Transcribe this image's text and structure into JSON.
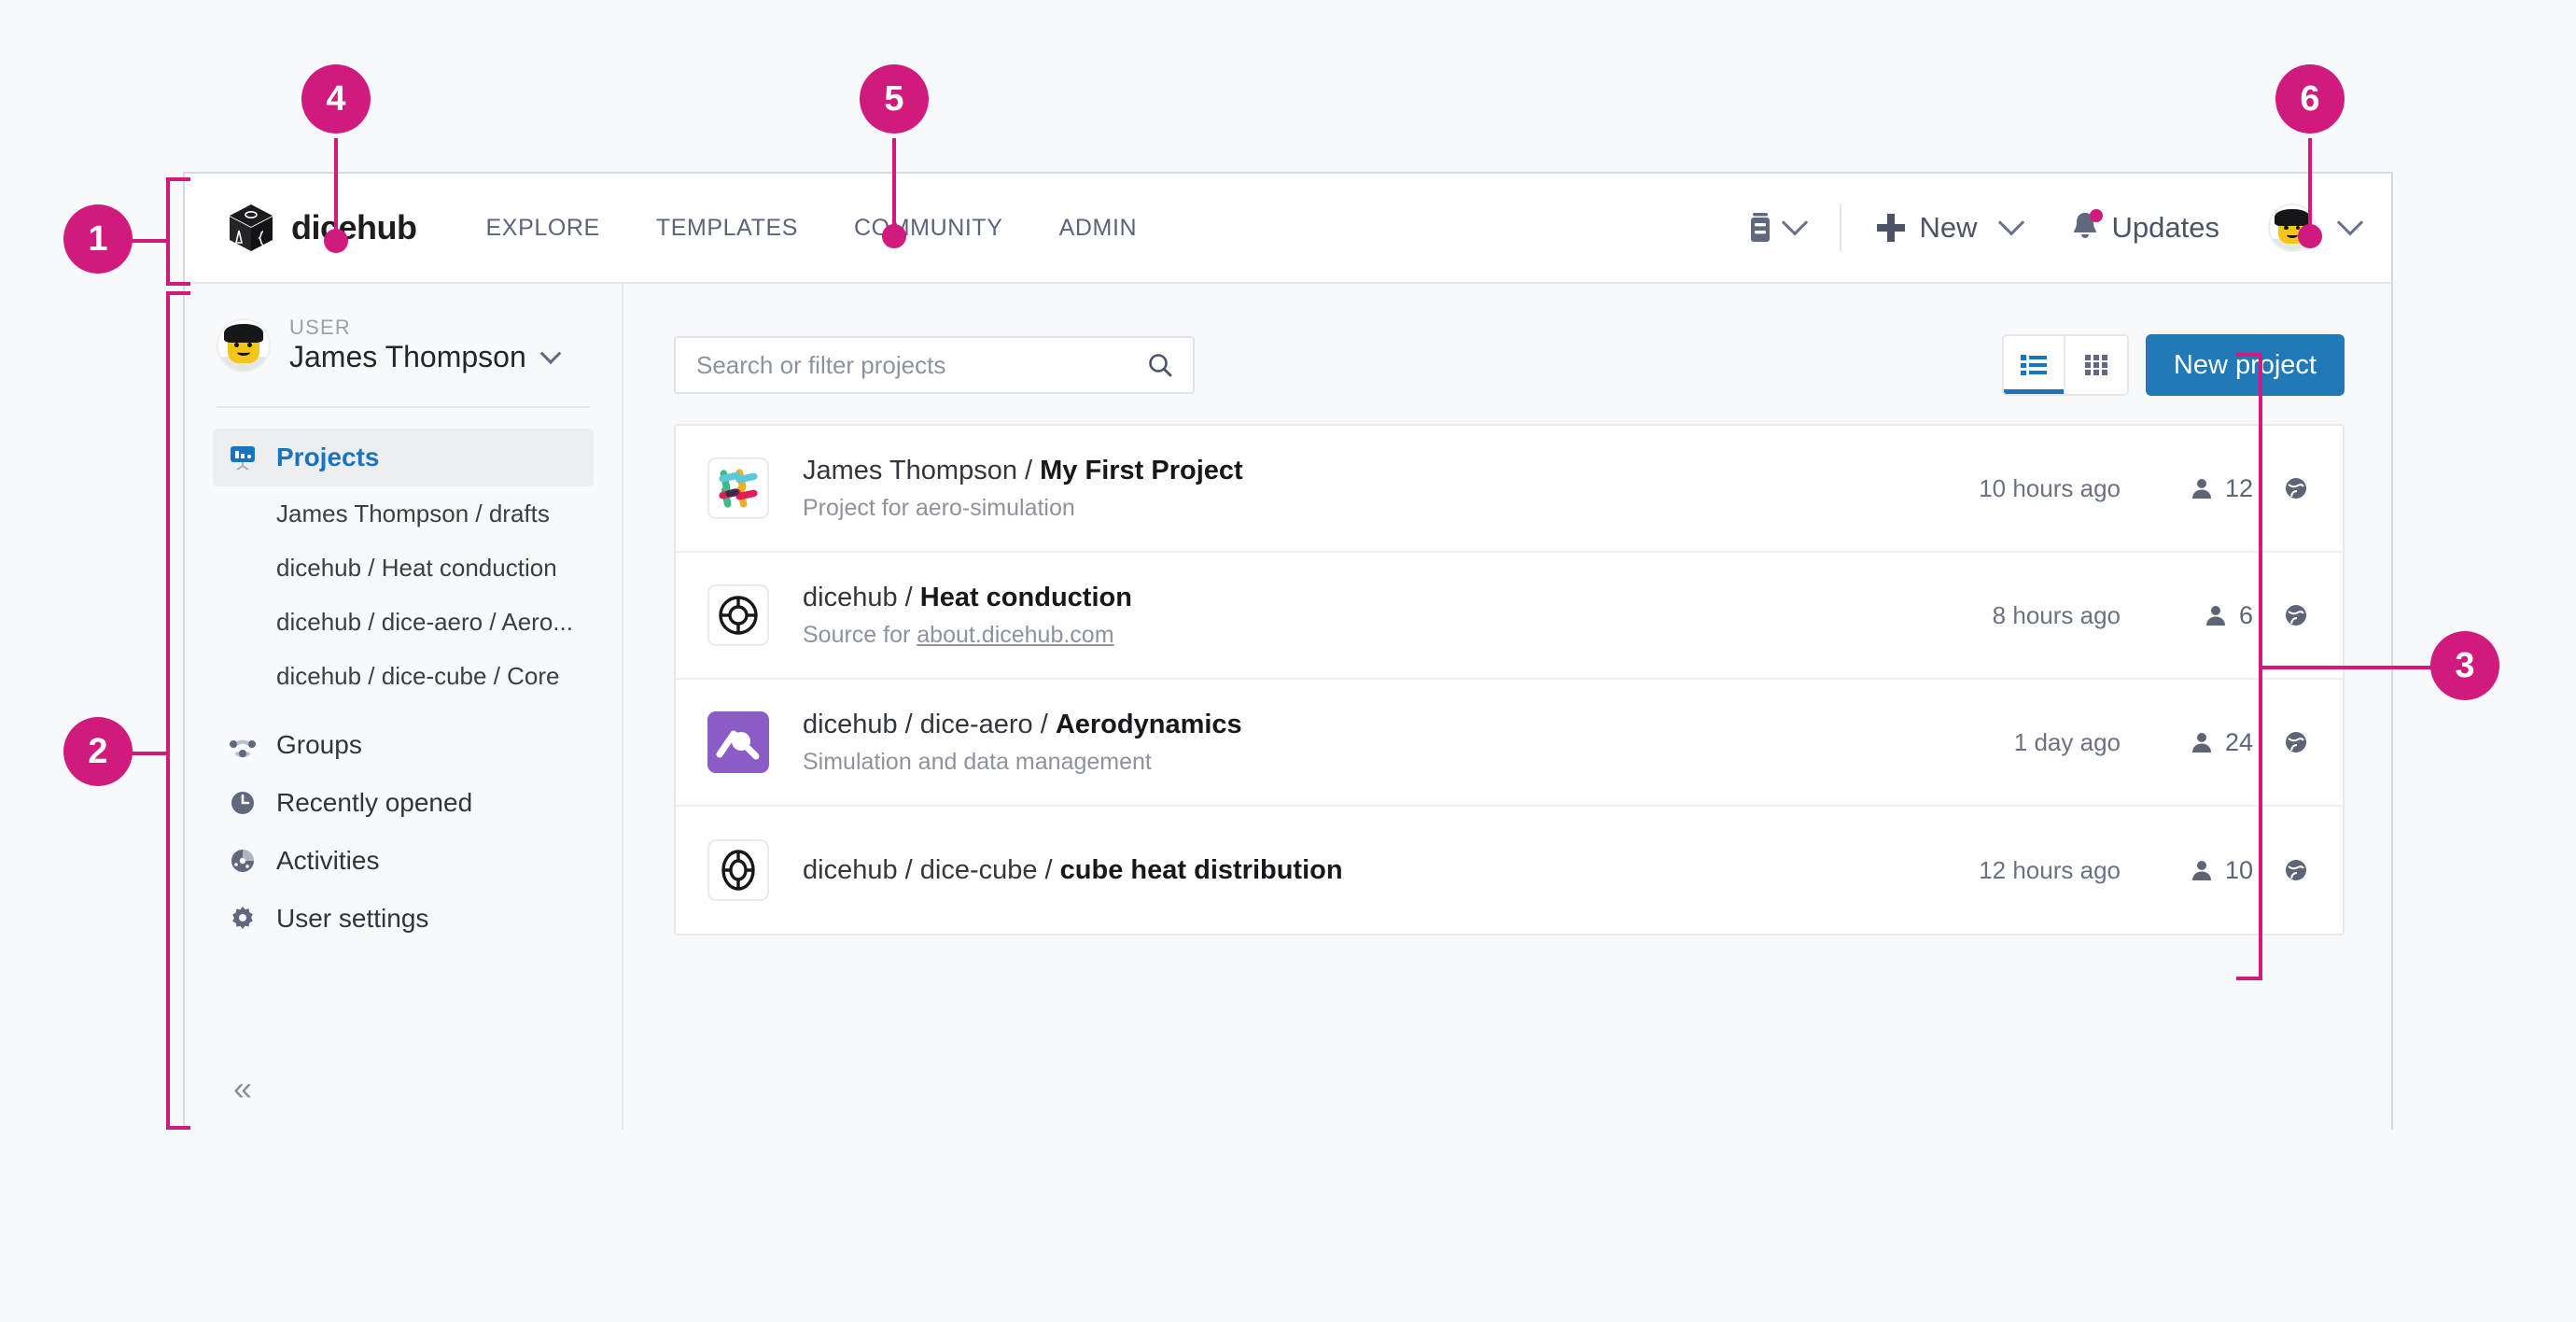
{
  "header": {
    "brand_name": "dicehub",
    "brand_icon": "dicehub-cube-logo",
    "nav": [
      {
        "label": "EXPLORE",
        "name": "nav-explore"
      },
      {
        "label": "TEMPLATES",
        "name": "nav-templates"
      },
      {
        "label": "COMMUNITY",
        "name": "nav-community"
      },
      {
        "label": "ADMIN",
        "name": "nav-admin"
      }
    ],
    "storage_icon": "database-icon",
    "new_label": "New",
    "new_icon": "plus-icon",
    "updates_label": "Updates",
    "updates_icon": "bell-icon",
    "updates_has_badge": true,
    "avatar_icon": "user-avatar",
    "chevron_icon": "chevron-down-icon"
  },
  "sidebar": {
    "user_label": "USER",
    "user_name": "James Thompson",
    "avatar_icon": "user-avatar",
    "chevron_icon": "chevron-down-icon",
    "projects": {
      "label": "Projects",
      "icon": "presentation-chart-icon"
    },
    "project_items": [
      {
        "label": "James Thompson / drafts",
        "name": "sidebar-project-drafts"
      },
      {
        "label": "dicehub / Heat conduction",
        "name": "sidebar-project-heat-conduction"
      },
      {
        "label": "dicehub / dice-aero / Aero...",
        "name": "sidebar-project-aero"
      },
      {
        "label": "dicehub / dice-cube / Core",
        "name": "sidebar-project-core"
      }
    ],
    "nav_items": [
      {
        "label": "Groups",
        "icon": "groups-network-icon",
        "name": "sidebar-item-groups"
      },
      {
        "label": "Recently opened",
        "icon": "clock-icon",
        "name": "sidebar-item-recently-opened"
      },
      {
        "label": "Activities",
        "icon": "activity-pie-icon",
        "name": "sidebar-item-activities"
      },
      {
        "label": "User settings",
        "icon": "gear-icon",
        "name": "sidebar-item-user-settings"
      }
    ],
    "collapse_icon": "double-chevron-left-icon",
    "collapse_glyph": "«"
  },
  "main": {
    "search_placeholder": "Search or filter projects",
    "search_value": "",
    "search_icon": "search-icon",
    "view_list_icon": "list-view-icon",
    "view_grid_icon": "grid-view-icon",
    "active_view": "list",
    "new_project_label": "New project",
    "projects": [
      {
        "namespace": "James Thompson / ",
        "name": "My First Project",
        "subtitle": "Project for aero-simulation",
        "subtitle_link": "",
        "time": "10 hours ago",
        "members": "12",
        "visibility_icon": "globe-icon",
        "tile_icon": "hash-colored-icon"
      },
      {
        "namespace": "dicehub / ",
        "name": "Heat conduction",
        "subtitle": "Source for ",
        "subtitle_link": "about.dicehub.com",
        "time": "8 hours ago",
        "members": "6",
        "visibility_icon": "globe-icon",
        "tile_icon": "lifebuoy-icon"
      },
      {
        "namespace": "dicehub / dice-aero / ",
        "name": "Aerodynamics",
        "subtitle": "Simulation and data management",
        "subtitle_link": "",
        "time": "1 day ago",
        "members": "24",
        "visibility_icon": "globe-icon",
        "tile_icon": "purple-magnifier-icon"
      },
      {
        "namespace": "dicehub / dice-cube / ",
        "name": "cube heat distribution",
        "subtitle": "",
        "subtitle_link": "",
        "time": "12 hours ago",
        "members": "10",
        "visibility_icon": "globe-icon",
        "tile_icon": "lifebuoy-icon"
      }
    ],
    "member_icon": "person-icon"
  },
  "annotations": {
    "color": "#d11a7d",
    "markers": [
      {
        "number": "1",
        "name": "callout-1-app-window"
      },
      {
        "number": "2",
        "name": "callout-2-sidebar"
      },
      {
        "number": "3",
        "name": "callout-3-project-list"
      },
      {
        "number": "4",
        "name": "callout-4-logo"
      },
      {
        "number": "5",
        "name": "callout-5-community-nav"
      },
      {
        "number": "6",
        "name": "callout-6-account-menu"
      }
    ]
  }
}
